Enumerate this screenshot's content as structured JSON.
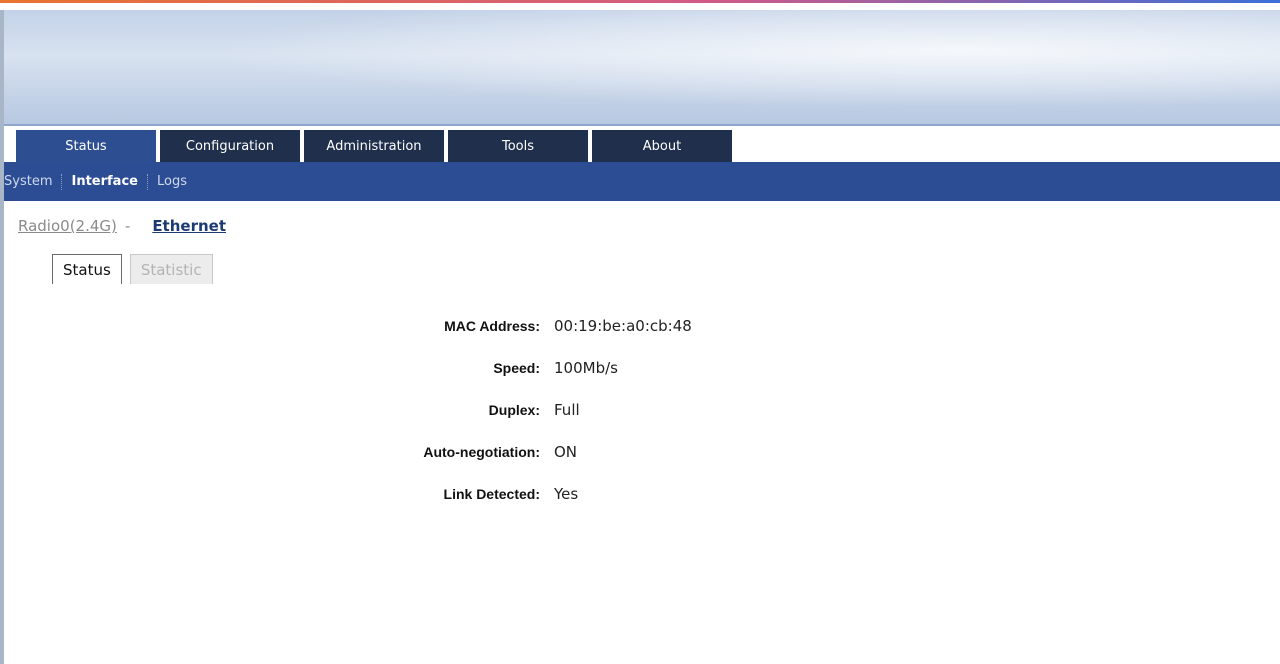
{
  "main_nav": {
    "tabs": [
      {
        "label": "Status",
        "active": true
      },
      {
        "label": "Configuration",
        "active": false
      },
      {
        "label": "Administration",
        "active": false
      },
      {
        "label": "Tools",
        "active": false
      },
      {
        "label": "About",
        "active": false
      }
    ]
  },
  "sub_nav": {
    "items": [
      {
        "label": "System",
        "active": false
      },
      {
        "label": "Interface",
        "active": true
      },
      {
        "label": "Logs",
        "active": false
      }
    ]
  },
  "interfaces": {
    "radio_label": "Radio0(2.4G)",
    "separator": "-",
    "ethernet_label": "Ethernet"
  },
  "subtabs": {
    "status_label": "Status",
    "statistic_label": "Statistic"
  },
  "details": {
    "mac_label": "MAC Address:",
    "mac_value": "00:19:be:a0:cb:48",
    "speed_label": "Speed:",
    "speed_value": "100Mb/s",
    "duplex_label": "Duplex:",
    "duplex_value": "Full",
    "autoneg_label": "Auto-negotiation:",
    "autoneg_value": "ON",
    "link_label": "Link Detected:",
    "link_value": "Yes"
  },
  "colors": {
    "nav_dark": "#1f2f4c",
    "nav_active": "#2e4e92",
    "subnav_bg": "#2c4d94",
    "link_active": "#1c3b73"
  }
}
